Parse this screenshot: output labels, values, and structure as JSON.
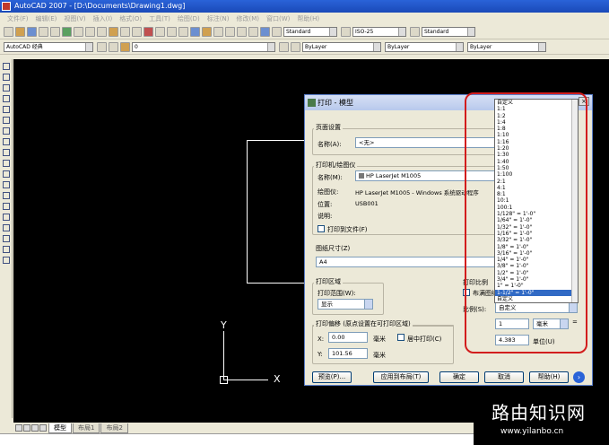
{
  "window": {
    "title": "AutoCAD 2007 - [D:\\Documents\\Drawing1.dwg]"
  },
  "menu": [
    "文件(F)",
    "编辑(E)",
    "视图(V)",
    "插入(I)",
    "格式(O)",
    "工具(T)",
    "绘图(D)",
    "标注(N)",
    "修改(M)",
    "窗口(W)",
    "帮助(H)"
  ],
  "toolbar": {
    "text_style": "Standard",
    "dim_style": "ISO-25",
    "table_style": "Standard",
    "workspace": "AutoCAD 经典",
    "layer": "0",
    "color": "ByLayer",
    "linetype": "ByLayer",
    "lineweight": "ByLayer"
  },
  "drawing": {
    "y_axis": "Y",
    "x_axis": "X"
  },
  "layout_tabs": [
    "模型",
    "布局1",
    "布局2"
  ],
  "watermark": {
    "title": "路由知识网",
    "url": "www.yilanbo.cn"
  },
  "dialog": {
    "title": "打印 - 模型",
    "page_setup": {
      "group": "页面设置",
      "name_label": "名称(A):",
      "name_value": "<无>"
    },
    "printer": {
      "group": "打印机/绘图仪",
      "name_label": "名称(M):",
      "name_value": "HP LaserJet M1005",
      "plotter_label": "绘图仪:",
      "plotter_value": "HP LaserJet M1005 - Windows 系统驱动程序",
      "location_label": "位置:",
      "location_value": "USB001",
      "desc_label": "说明:",
      "print_to_file": "打印到文件(F)"
    },
    "paper": {
      "group": "图纸尺寸(Z)",
      "value": "A4"
    },
    "area": {
      "group": "打印区域",
      "range_label": "打印范围(W):",
      "range_value": "显示"
    },
    "offset": {
      "group": "打印偏移 (原点设置在可打印区域)",
      "x_label": "X:",
      "x_value": "0.00",
      "x_unit": "毫米",
      "y_label": "Y:",
      "y_value": "101.56",
      "y_unit": "毫米",
      "center": "居中打印(C)"
    },
    "scale": {
      "group": "打印比例",
      "fit": "布满图纸",
      "ratio_label": "比例(S):",
      "ratio_value": "自定义",
      "value1": "1",
      "unit1": "毫米",
      "equals": "=",
      "value2": "4.383",
      "unit2": "单位(U)"
    },
    "buttons": {
      "preview": "预览(P)...",
      "apply": "应用到布局(T)",
      "ok": "确定",
      "cancel": "取消",
      "help": "帮助(H)"
    },
    "scale_list": [
      "自定义",
      "1:1",
      "1:2",
      "1:4",
      "1:8",
      "1:10",
      "1:16",
      "1:20",
      "1:30",
      "1:40",
      "1:50",
      "1:100",
      "2:1",
      "4:1",
      "8:1",
      "10:1",
      "100:1",
      "1/128\" = 1'-0\"",
      "1/64\" = 1'-0\"",
      "1/32\" = 1'-0\"",
      "1/16\" = 1'-0\"",
      "3/32\" = 1'-0\"",
      "1/8\" = 1'-0\"",
      "3/16\" = 1'-0\"",
      "1/4\" = 1'-0\"",
      "3/8\" = 1'-0\"",
      "1/2\" = 1'-0\"",
      "3/4\" = 1'-0\"",
      "1\" = 1'-0\"",
      "1-1/2\" = 1'-0\"",
      "自定义"
    ],
    "scale_list_selected": 29
  }
}
